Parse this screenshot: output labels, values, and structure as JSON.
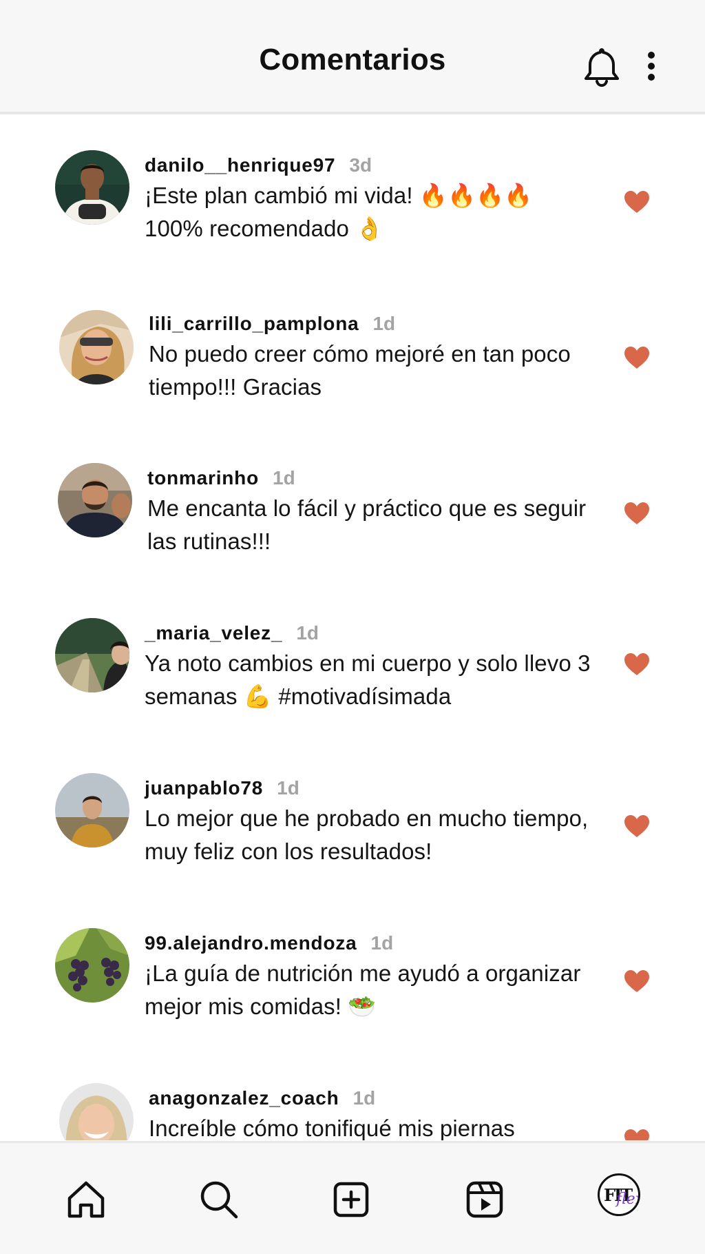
{
  "header": {
    "title": "Comentarios",
    "bell_icon": "bell-icon",
    "more_icon": "more-vertical-icon"
  },
  "colors": {
    "heart": "#d9674a",
    "timestamp": "#a3a3a3",
    "header_bg": "#f7f7f7"
  },
  "comments": [
    {
      "username": "danilo__henrique97",
      "time": "3d",
      "text": "¡Este plan cambió mi vida! 🔥🔥🔥🔥 100% recomendado 👌",
      "liked": true
    },
    {
      "username": "lili_carrillo_pamplona",
      "time": "1d",
      "text": "No puedo creer cómo mejoré en tan poco tiempo!!! Gracias",
      "liked": true
    },
    {
      "username": "tonmarinho",
      "time": "1d",
      "text": "Me encanta lo fácil y práctico que es seguir las rutinas!!!",
      "liked": true
    },
    {
      "username": "_maria_velez_",
      "time": "1d",
      "text": "Ya noto cambios en mi cuerpo y solo llevo 3 semanas 💪 #motivadísimada",
      "liked": true
    },
    {
      "username": "juanpablo78",
      "time": "1d",
      "text": "Lo mejor que he probado en mucho tiempo, muy feliz con los resultados!",
      "liked": true
    },
    {
      "username": "99.alejandro.mendoza",
      "time": "1d",
      "text": "¡La guía de nutrición me ayudó a organizar mejor mis comidas! 🥗",
      "liked": true
    },
    {
      "username": "anagonzalez_coach",
      "time": "1d",
      "text": "Increíble cómo tonifiqué mis piernas",
      "liked": true
    }
  ],
  "bottom_nav": {
    "items": [
      "home-icon",
      "search-icon",
      "add-post-icon",
      "reels-icon",
      "profile-avatar"
    ],
    "profile_logo_fit": "FIT",
    "profile_logo_flex": "flex"
  }
}
